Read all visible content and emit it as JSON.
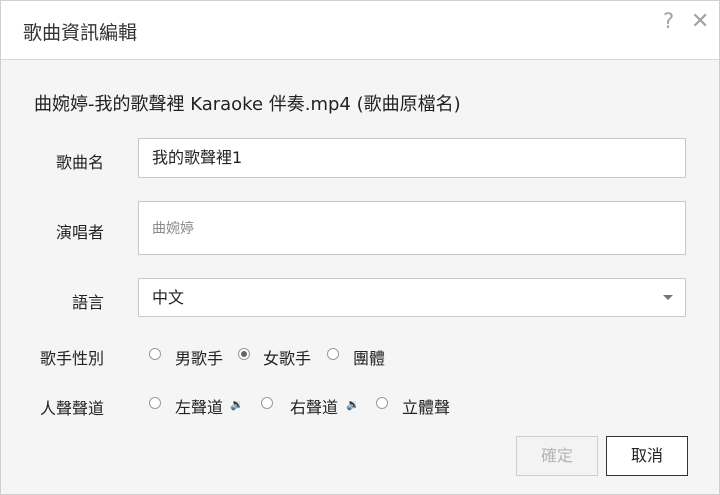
{
  "dialog": {
    "title": "歌曲資訊編輯",
    "help_glyph": "?",
    "close_glyph": "✕",
    "source_filename": "曲婉婷-我的歌聲裡 Karaoke 伴奏.mp4 (歌曲原檔名)"
  },
  "form": {
    "song_name": {
      "label": "歌曲名",
      "value": "我的歌聲裡1"
    },
    "singer": {
      "label": "演唱者",
      "value": "",
      "placeholder": "曲婉婷"
    },
    "language": {
      "label": "語言",
      "value": "中文"
    },
    "gender": {
      "label": "歌手性別",
      "options": [
        "男歌手",
        "女歌手",
        "團體"
      ],
      "selected": "女歌手"
    },
    "channel": {
      "label": "人聲聲道",
      "options": [
        "左聲道",
        "右聲道",
        "立體聲"
      ],
      "speaker_glyph": "🔉"
    }
  },
  "buttons": {
    "ok": "確定",
    "cancel": "取消"
  }
}
